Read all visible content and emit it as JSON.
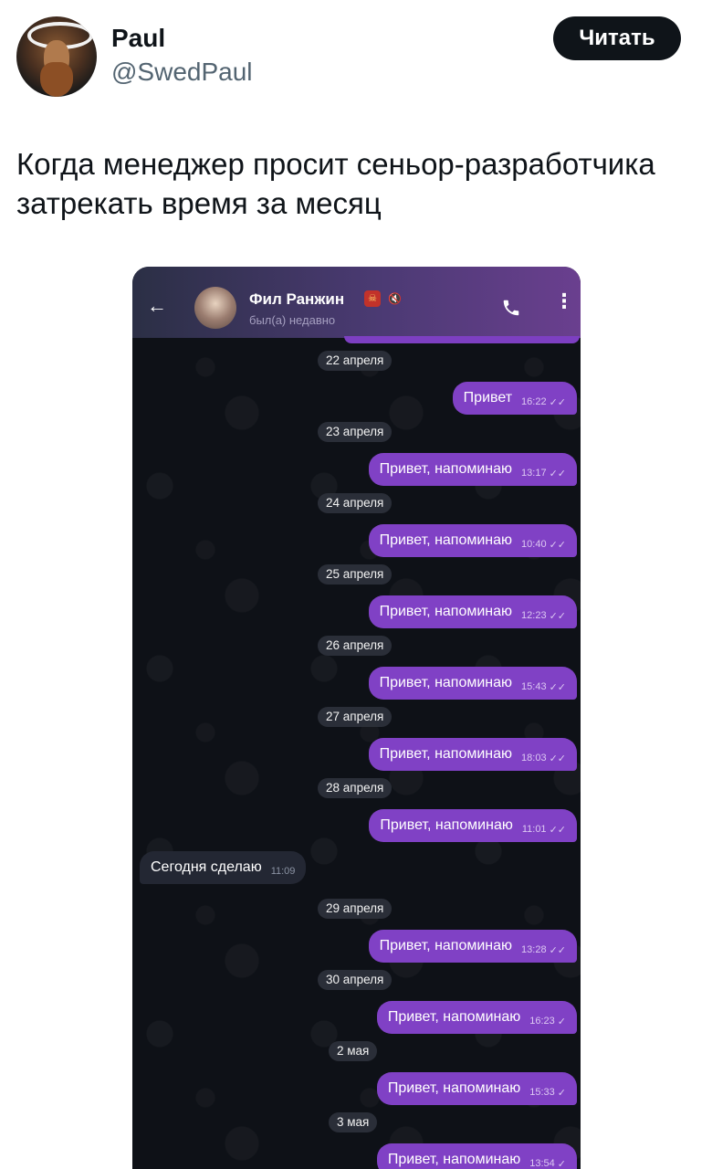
{
  "tweet": {
    "author_name": "Paul",
    "author_handle": "@SwedPaul",
    "follow_label": "Читать",
    "text": "Когда менеджер просит сеньор-разработчика затрекать время за месяц"
  },
  "chat": {
    "contact_name": "Фил Ранжин",
    "contact_status": "был(а) недавно",
    "back_icon": "arrow-left-icon",
    "call_icon": "phone-icon",
    "menu_icon": "more-vertical-icon",
    "dates": [
      "22 апреля",
      "23 апреля",
      "24 апреля",
      "25 апреля",
      "26 апреля",
      "27 апреля",
      "28 апреля",
      "29 апреля",
      "30 апреля",
      "2 мая",
      "3 мая"
    ],
    "messages": [
      {
        "text": "Привет",
        "time": "16:22",
        "outgoing": true,
        "read": true
      },
      {
        "text": "Привет, напоминаю",
        "time": "13:17",
        "outgoing": true,
        "read": true
      },
      {
        "text": "Привет, напоминаю",
        "time": "10:40",
        "outgoing": true,
        "read": true
      },
      {
        "text": "Привет, напоминаю",
        "time": "12:23",
        "outgoing": true,
        "read": true
      },
      {
        "text": "Привет, напоминаю",
        "time": "15:43",
        "outgoing": true,
        "read": true
      },
      {
        "text": "Привет, напоминаю",
        "time": "18:03",
        "outgoing": true,
        "read": true
      },
      {
        "text": "Привет, напоминаю",
        "time": "11:01",
        "outgoing": true,
        "read": true
      },
      {
        "text": "Сегодня сделаю",
        "time": "11:09",
        "outgoing": false
      },
      {
        "text": "Привет, напоминаю",
        "time": "13:28",
        "outgoing": true,
        "read": true
      },
      {
        "text": "Привет, напоминаю",
        "time": "16:23",
        "outgoing": true,
        "read": false
      },
      {
        "text": "Привет, напоминаю",
        "time": "15:33",
        "outgoing": true,
        "read": false
      },
      {
        "text": "Привет, напоминаю",
        "time": "13:54",
        "outgoing": true,
        "read": false
      }
    ]
  }
}
